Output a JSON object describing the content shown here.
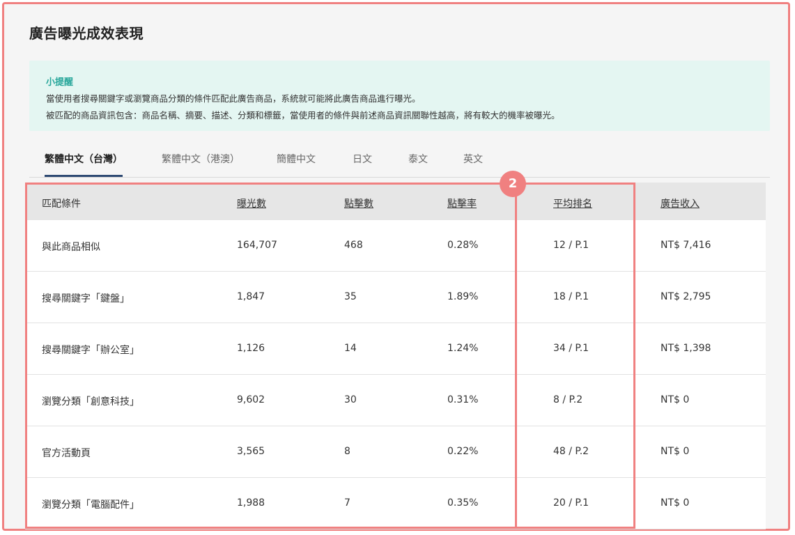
{
  "page": {
    "title": "廣告曝光成效表現"
  },
  "tip": {
    "title": "小提醒",
    "line1": "當使用者搜尋關鍵字或瀏覽商品分類的條件匹配此廣告商品，系統就可能將此廣告商品進行曝光。",
    "line2": "被匹配的商品資訊包含：商品名稱、摘要、描述、分類和標籤，當使用者的條件與前述商品資訊關聯性越高，將有較大的機率被曝光。"
  },
  "tabs": [
    {
      "label": "繁體中文（台灣）",
      "active": true
    },
    {
      "label": "繁體中文（港澳）",
      "active": false
    },
    {
      "label": "簡體中文",
      "active": false
    },
    {
      "label": "日文",
      "active": false
    },
    {
      "label": "泰文",
      "active": false
    },
    {
      "label": "英文",
      "active": false
    }
  ],
  "table": {
    "headers": [
      "匹配條件",
      "曝光數",
      "點擊數",
      "點擊率",
      "平均排名",
      "廣告收入"
    ],
    "rows": [
      [
        "與此商品相似",
        "164,707",
        "468",
        "0.28%",
        "12 / P.1",
        "NT$ 7,416"
      ],
      [
        "搜尋關鍵字「鍵盤」",
        "1,847",
        "35",
        "1.89%",
        "18 / P.1",
        "NT$ 2,795"
      ],
      [
        "搜尋關鍵字「辦公室」",
        "1,126",
        "14",
        "1.24%",
        "34 / P.1",
        "NT$ 1,398"
      ],
      [
        "瀏覽分類「創意科技」",
        "9,602",
        "30",
        "0.31%",
        "8 / P.2",
        "NT$ 0"
      ],
      [
        "官方活動頁",
        "3,565",
        "8",
        "0.22%",
        "48 / P.2",
        "NT$ 0"
      ],
      [
        "瀏覽分類「電腦配件」",
        "1,988",
        "7",
        "0.35%",
        "20 / P.1",
        "NT$ 0"
      ]
    ]
  },
  "annotation": {
    "badge": "2"
  },
  "colors": {
    "highlight": "#f08080",
    "tip_bg": "#e4f6f2",
    "tip_title": "#26a69a",
    "tab_active_underline": "#2e4a73",
    "header_bg": "#e6e6e6"
  }
}
